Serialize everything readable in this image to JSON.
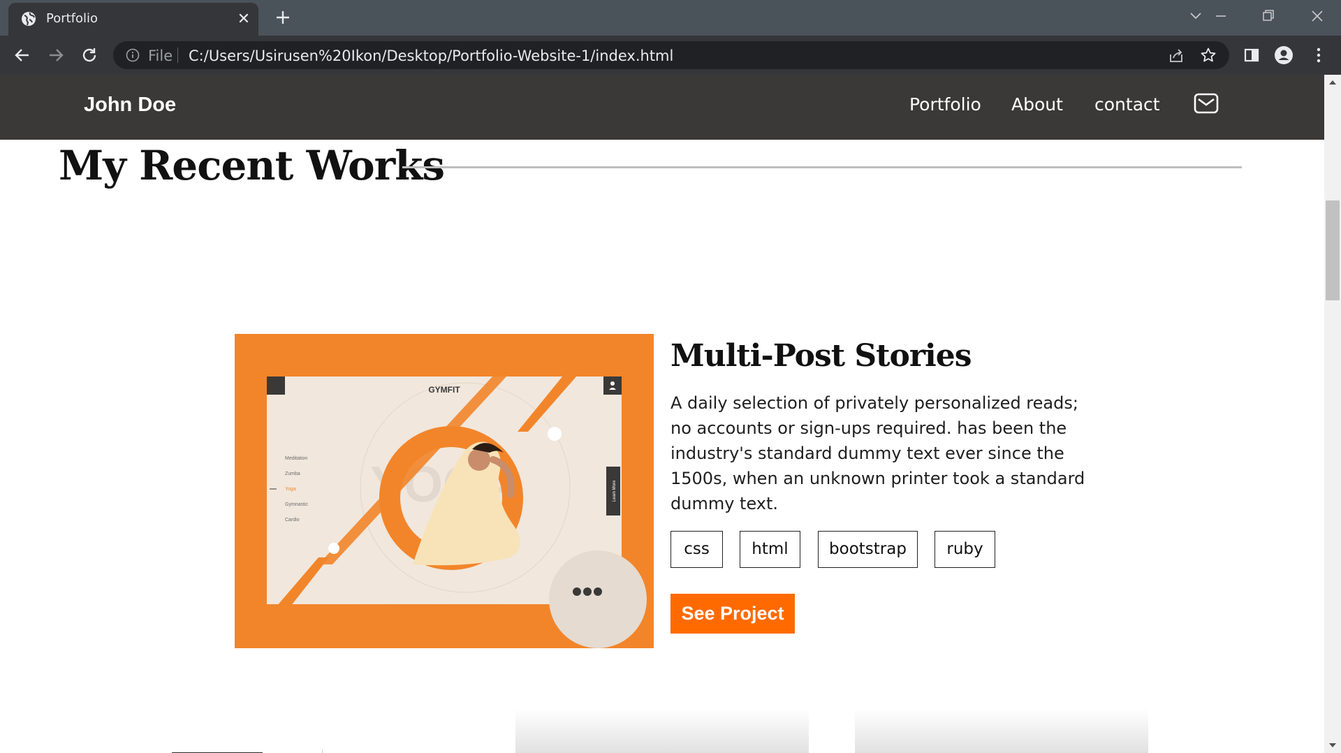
{
  "browser": {
    "tab_title": "Portfolio",
    "address_scheme": "File",
    "url": "C:/Users/Usirusen%20Ikon/Desktop/Portfolio-Website-1/index.html"
  },
  "site": {
    "brand": "John Doe",
    "nav": [
      {
        "label": "Portfolio"
      },
      {
        "label": "About"
      },
      {
        "label": "contact"
      }
    ]
  },
  "works": {
    "section_title": "My Recent Works",
    "project": {
      "title": "Multi-Post Stories",
      "description": "A daily selection of privately personalized reads; no accounts or sign-ups required. has been the industry's standard dummy text ever since the 1500s, when an unknown printer took a standard dummy text.",
      "tags": [
        "css",
        "html",
        "bootstrap",
        "ruby"
      ],
      "cta": "See Project",
      "image": {
        "brand": "GYMFIT",
        "menu_items": [
          "Meditation",
          "Zumba",
          "Yoga",
          "Gymnastic",
          "Cardio"
        ],
        "background_word": "YOGA",
        "side_button": "Learn More"
      }
    }
  },
  "colors": {
    "header_bg": "#3a3938",
    "accent": "#ff6a00",
    "image_bg": "#f2852a"
  }
}
